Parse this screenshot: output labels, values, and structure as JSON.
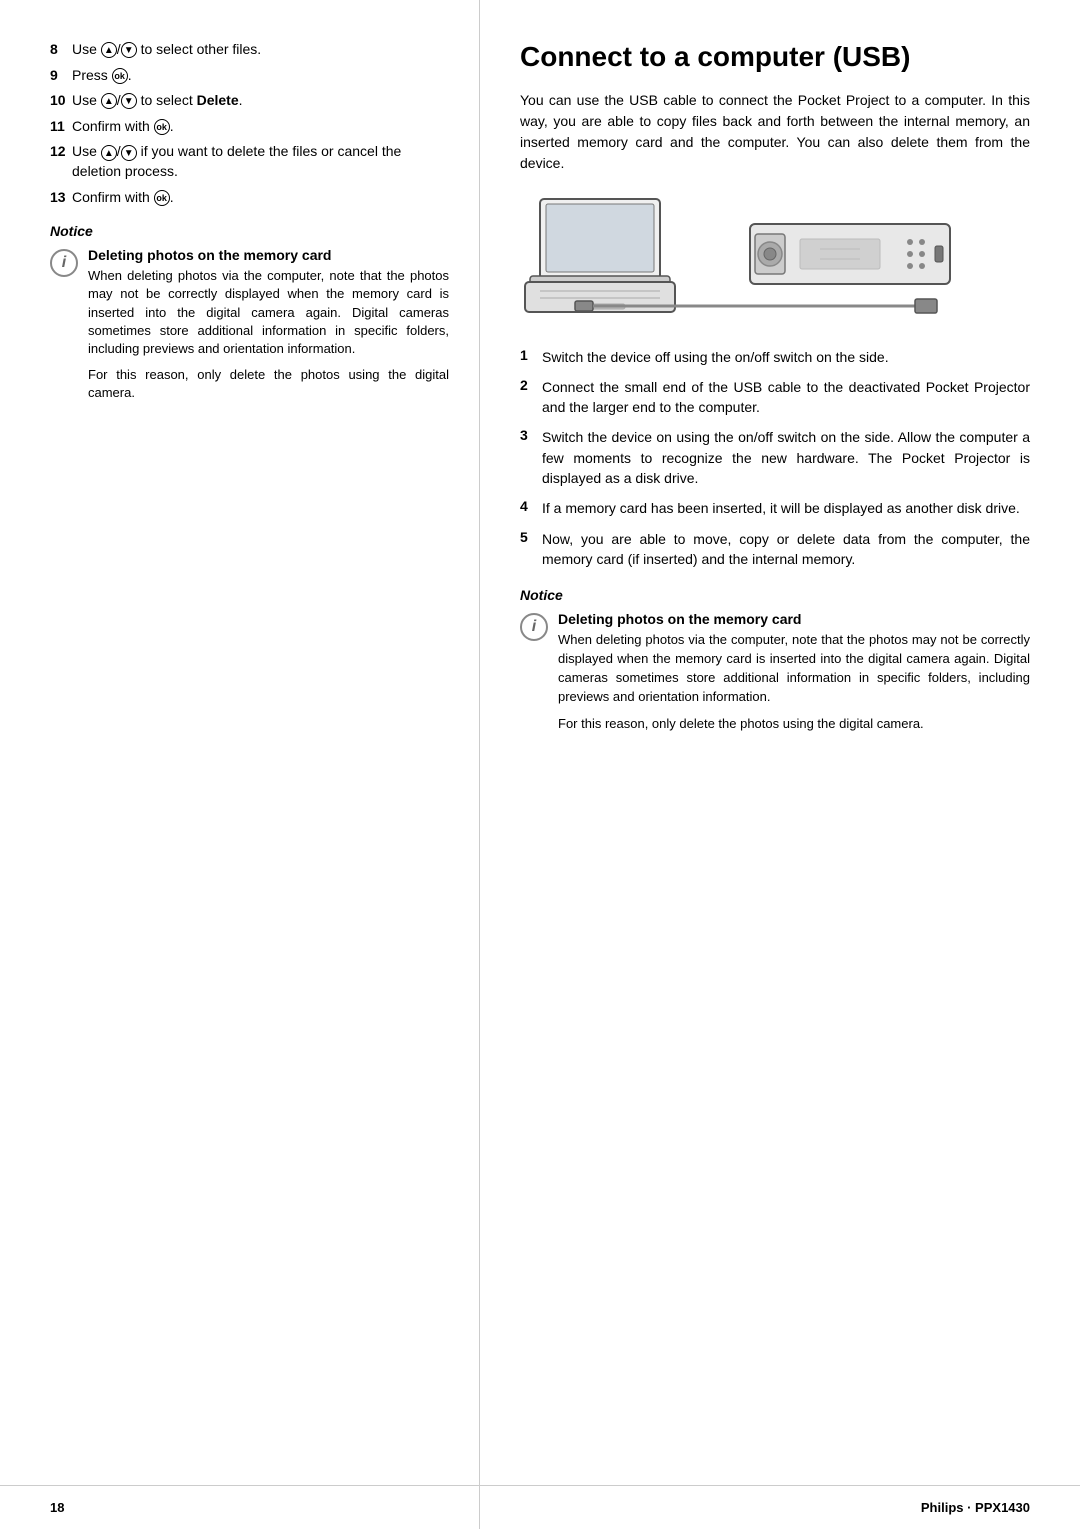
{
  "left": {
    "steps": [
      {
        "num": "8",
        "text": "Use ",
        "arrows": true,
        "rest": " to select other files."
      },
      {
        "num": "9",
        "text": "Press ",
        "ok": true,
        "rest": "."
      },
      {
        "num": "10",
        "text": "Use ",
        "arrows": true,
        "rest": " to select ",
        "bold_word": "Delete",
        "after": "."
      },
      {
        "num": "11",
        "text": "Confirm with ",
        "ok": true,
        "rest": "."
      },
      {
        "num": "12",
        "text": "Use ",
        "arrows": true,
        "rest": " if you want to delete the files or cancel the deletion process."
      },
      {
        "num": "13",
        "text": "Confirm with ",
        "ok": true,
        "rest": "."
      }
    ],
    "notice_label": "Notice",
    "notice_title": "Deleting photos on the memory card",
    "notice_body_1": "When deleting photos via the computer, note that the photos may not be correctly displayed when the memory card is inserted into the digital camera again. Digital cameras sometimes store additional information in specific folders, including previews and orientation information.",
    "notice_body_2": "For this reason, only delete the photos using the digital camera."
  },
  "right": {
    "section_title": "Connect to a computer (USB)",
    "intro": "You can use the USB cable to connect the Pocket Project to a computer. In this way, you are able to copy files back and forth between the internal memory, an inserted memory card and the computer. You can also delete them from the device.",
    "steps": [
      {
        "num": "1",
        "text": "Switch the device off using the on/off switch on the side."
      },
      {
        "num": "2",
        "text": "Connect the small end of the USB cable to the deactivated Pocket Projector and the larger end to the computer."
      },
      {
        "num": "3",
        "text": "Switch the device on using the on/off switch on the side. Allow the computer a few moments to recognize the new hardware. The Pocket Projector is displayed as a disk drive."
      },
      {
        "num": "4",
        "text": "If a memory card has been inserted, it will be displayed as another disk drive."
      },
      {
        "num": "5",
        "text": "Now, you are able to move, copy or delete data from the computer, the memory card (if inserted) and the internal memory."
      }
    ],
    "notice_label": "Notice",
    "notice_title": "Deleting photos on the memory card",
    "notice_body_1": "When deleting photos via the computer, note that the photos may not be correctly displayed when the memory card is inserted into the digital camera again. Digital cameras sometimes store additional information in specific folders, including previews and orientation information.",
    "notice_body_2": "For this reason, only delete the photos using the digital camera."
  },
  "footer": {
    "page_num": "18",
    "brand": "Philips · PPX1430"
  }
}
